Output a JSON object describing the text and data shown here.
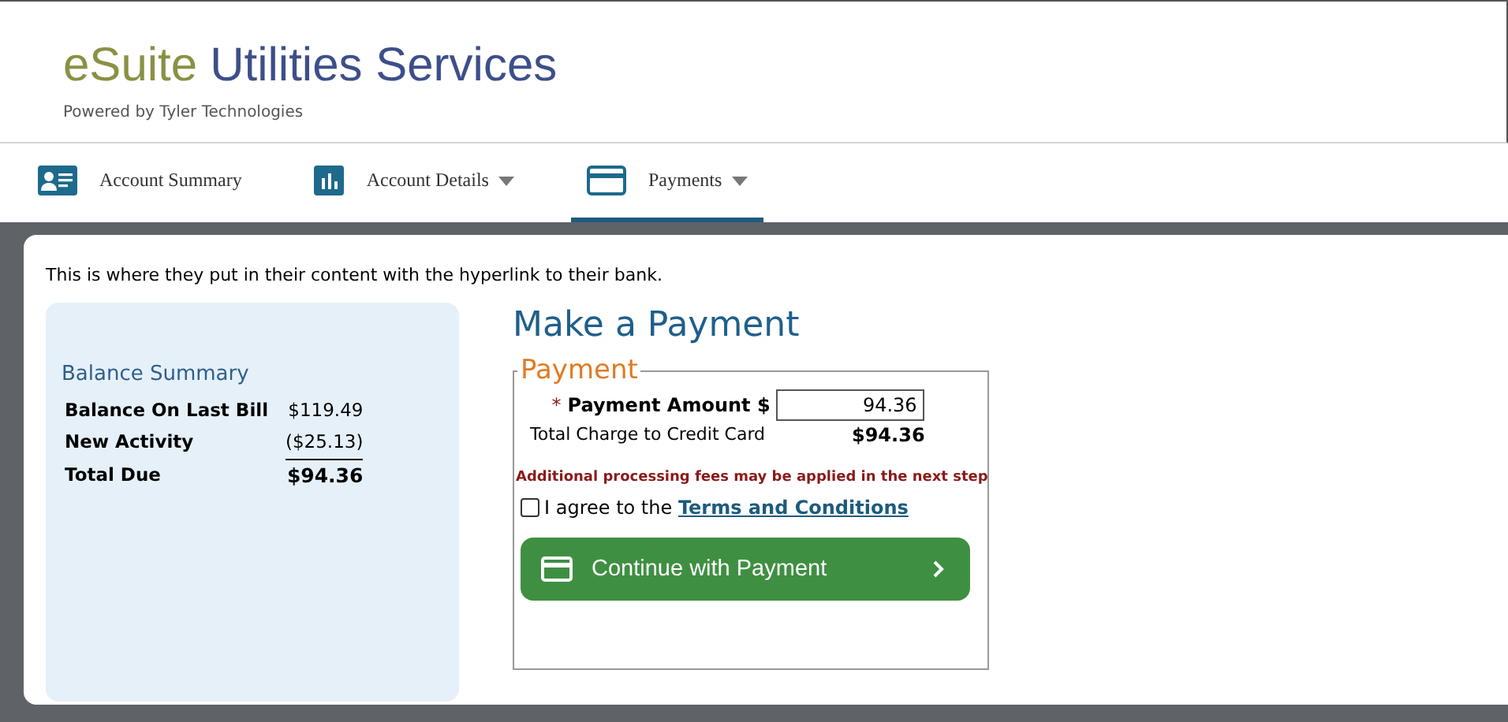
{
  "header": {
    "brand": "eSuite",
    "title": "Utilities Services",
    "subtitle": "Powered by Tyler Technologies"
  },
  "tabs": [
    {
      "label": "Account Summary",
      "kind": "profile",
      "dropdown": false,
      "selected": false
    },
    {
      "label": "Account Details",
      "kind": "details",
      "dropdown": true,
      "selected": false
    },
    {
      "label": "Payments",
      "kind": "payment",
      "dropdown": true,
      "selected": true
    }
  ],
  "intro": "This is where they put in their content with the hyperlink to their bank.",
  "balance_summary": {
    "title": "Balance Summary",
    "rows": [
      {
        "label": "Balance On Last Bill",
        "value": "$119.49",
        "kind": "line"
      },
      {
        "label": "New Activity",
        "value": "($25.13)",
        "kind": "subtotal"
      },
      {
        "label": "Total Due",
        "value": "$94.36",
        "kind": "total"
      }
    ]
  },
  "payment": {
    "heading": "Make a Payment",
    "legend": "Payment",
    "required_mark": "*",
    "amount_label": "Payment Amount $",
    "amount": "94.36",
    "charge_label": "Total Charge to Credit Card",
    "charge": "$94.36",
    "notice": "Additional processing fees may be applied in the next step",
    "agree": {
      "checked": false,
      "text": "I agree to the ",
      "link": "Terms and Conditions"
    },
    "button": "Continue with Payment"
  }
}
